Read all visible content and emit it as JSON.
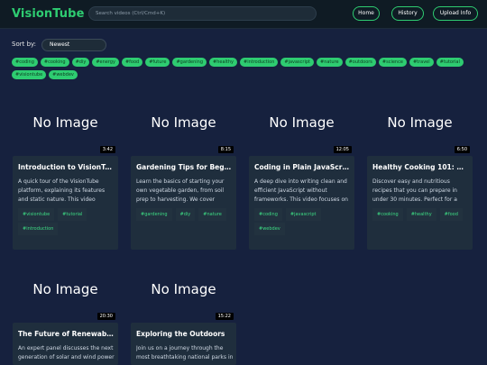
{
  "app": {
    "title": "VisionTube"
  },
  "header": {
    "search_placeholder": "Search videos (Ctrl/Cmd+K)",
    "home_label": "Home",
    "history_label": "History",
    "upload_label": "Upload Info"
  },
  "sort": {
    "label": "Sort by:",
    "selected": "Newest"
  },
  "tags": [
    "#coding",
    "#cooking",
    "#diy",
    "#energy",
    "#food",
    "#future",
    "#gardening",
    "#healthy",
    "#introduction",
    "#javascript",
    "#nature",
    "#outdoors",
    "#science",
    "#travel",
    "#tutorial",
    "#visiontube",
    "#webdev"
  ],
  "no_image_text": "No Image",
  "videos": [
    {
      "title": "Introduction to VisionTube",
      "duration": "3:42",
      "description": "A quick tour of the VisionTube platform, explaining its features and static nature. This video serve…",
      "tags": [
        "#visiontube",
        "#tutorial",
        "#introduction"
      ]
    },
    {
      "title": "Gardening Tips for Beginn…",
      "duration": "8:15",
      "description": "Learn the basics of starting your own vegetable garden, from soil prep to harvesting. We cover every…",
      "tags": [
        "#gardening",
        "#diy",
        "#nature"
      ]
    },
    {
      "title": "Coding in Plain JavaScript",
      "duration": "12:05",
      "description": "A deep dive into writing clean and efficient JavaScript without frameworks. This video focuses on co…",
      "tags": [
        "#coding",
        "#javascript",
        "#webdev"
      ]
    },
    {
      "title": "Healthy Cooking 101: Sim…",
      "duration": "6:50",
      "description": "Discover easy and nutritious recipes that you can prepare in under 30 minutes. Perfect for a quick l…",
      "tags": [
        "#cooking",
        "#healthy",
        "#food"
      ]
    },
    {
      "title": "The Future of Renewable E…",
      "duration": "20:30",
      "description": "An expert panel discusses the next generation of solar and wind power",
      "tags": []
    },
    {
      "title": "Exploring the Outdoors",
      "duration": "15:22",
      "description": "Join us on a journey through the most breathtaking national parks in",
      "tags": []
    }
  ]
}
